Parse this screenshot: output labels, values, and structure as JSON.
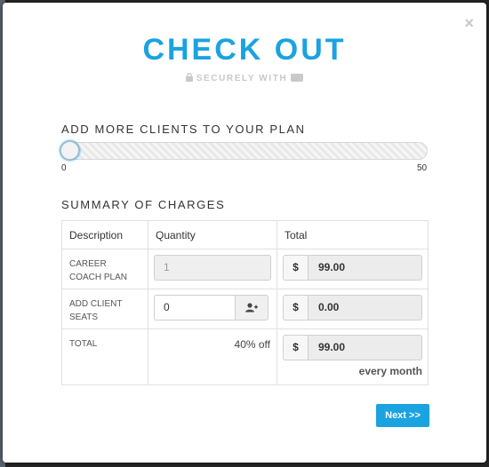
{
  "modal": {
    "close_label": "×",
    "title": "CHECK OUT",
    "secure_text": "SECURELY WITH"
  },
  "clients": {
    "section_label": "ADD MORE CLIENTS TO YOUR PLAN",
    "slider_min": "0",
    "slider_max": "50",
    "slider_value": 0
  },
  "summary": {
    "section_label": "SUMMARY OF CHARGES",
    "headers": [
      "Description",
      "Quantity",
      "Total"
    ],
    "rows": [
      {
        "description": "CAREER COACH PLAN",
        "quantity": "1",
        "currency": "$",
        "total": "99.00"
      },
      {
        "description": "ADD CLIENT SEATS",
        "quantity": "0",
        "currency": "$",
        "total": "0.00"
      },
      {
        "description": "TOTAL",
        "discount": "40% off",
        "currency": "$",
        "total": "99.00",
        "period": "every month"
      }
    ]
  },
  "actions": {
    "next_label": "Next >>"
  },
  "colors": {
    "accent": "#1aa3e0",
    "backdrop": "#262626"
  },
  "icons": {
    "lock": "lock-icon",
    "card": "credit-card-icon",
    "add_user": "add-user-icon",
    "close": "close-icon"
  }
}
